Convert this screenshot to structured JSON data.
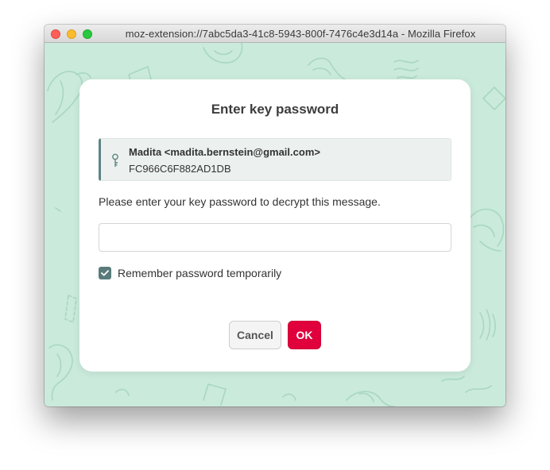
{
  "window": {
    "title": "moz-extension://7abc5da3-41c8-5943-800f-7476c4e3d14a - Mozilla Firefox",
    "buttons": [
      "close",
      "minimize",
      "maximize"
    ]
  },
  "dialog": {
    "title": "Enter key password",
    "key": {
      "icon": "key-icon",
      "user": "Madita <madita.bernstein@gmail.com>",
      "id": "FC966C6F882AD1DB"
    },
    "prompt": "Please enter your key password to decrypt this message.",
    "password": {
      "value": "",
      "placeholder": ""
    },
    "remember": {
      "label": "Remember password temporarily",
      "checked": true
    },
    "cancel_label": "Cancel",
    "ok_label": "OK"
  },
  "colors": {
    "background": "#caeadb",
    "accent": "#e0003c",
    "checkbox": "#597c7b",
    "key_border": "#5d8583"
  }
}
